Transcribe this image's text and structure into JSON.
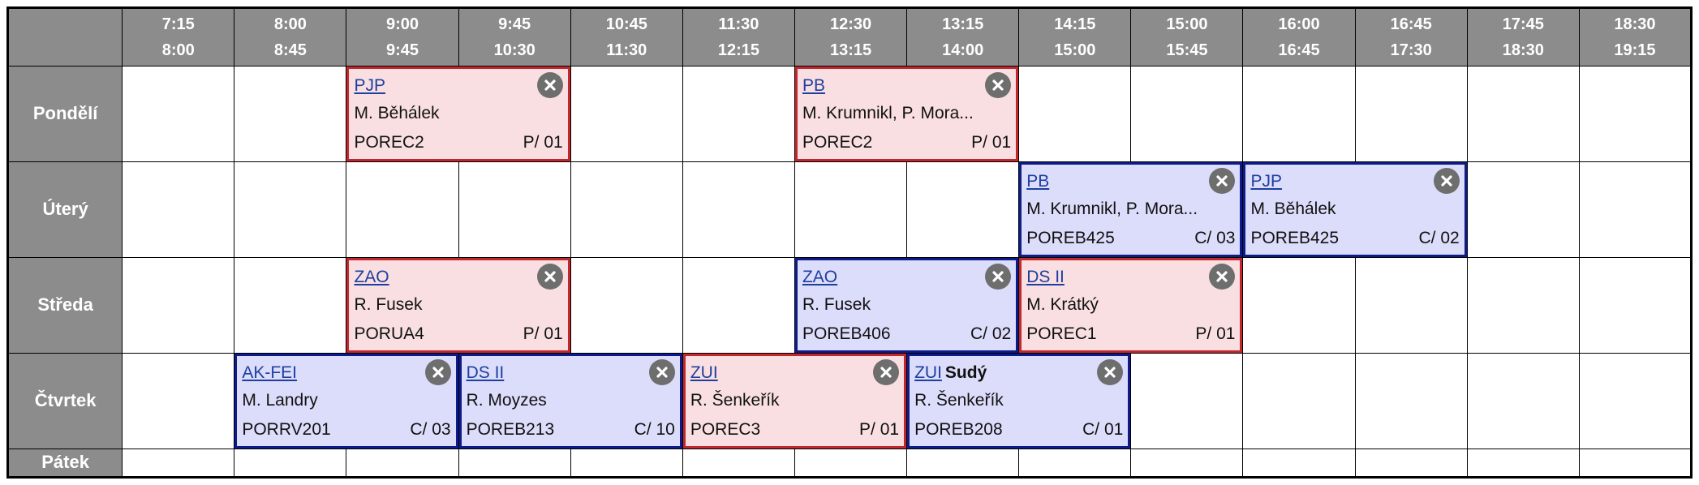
{
  "schedule": {
    "time_slots": [
      {
        "start": "7:15",
        "end": "8:00"
      },
      {
        "start": "8:00",
        "end": "8:45"
      },
      {
        "start": "9:00",
        "end": "9:45"
      },
      {
        "start": "9:45",
        "end": "10:30"
      },
      {
        "start": "10:45",
        "end": "11:30"
      },
      {
        "start": "11:30",
        "end": "12:15"
      },
      {
        "start": "12:30",
        "end": "13:15"
      },
      {
        "start": "13:15",
        "end": "14:00"
      },
      {
        "start": "14:15",
        "end": "15:00"
      },
      {
        "start": "15:00",
        "end": "15:45"
      },
      {
        "start": "16:00",
        "end": "16:45"
      },
      {
        "start": "16:45",
        "end": "17:30"
      },
      {
        "start": "17:45",
        "end": "18:30"
      },
      {
        "start": "18:30",
        "end": "19:15"
      }
    ],
    "days": [
      "Pondělí",
      "Úterý",
      "Středa",
      "Čtvrtek",
      "Pátek"
    ],
    "lessons": {
      "mon_pjp": {
        "code": "PJP",
        "teacher": "M. Běhálek",
        "room": "POREC2",
        "group": "P/ 01",
        "type": "lecture"
      },
      "mon_pb": {
        "code": "PB",
        "teacher": "M. Krumnikl, P. Mora...",
        "room": "POREC2",
        "group": "P/ 01",
        "type": "lecture"
      },
      "tue_pb": {
        "code": "PB",
        "teacher": "M. Krumnikl, P. Mora...",
        "room": "POREB425",
        "group": "C/ 03",
        "type": "exercise"
      },
      "tue_pjp": {
        "code": "PJP",
        "teacher": "M. Běhálek",
        "room": "POREB425",
        "group": "C/ 02",
        "type": "exercise"
      },
      "wed_zao_lec": {
        "code": "ZAO",
        "teacher": "R. Fusek",
        "room": "PORUA4",
        "group": "P/ 01",
        "type": "lecture"
      },
      "wed_zao_ex": {
        "code": "ZAO",
        "teacher": "R. Fusek",
        "room": "POREB406",
        "group": "C/ 02",
        "type": "exercise"
      },
      "wed_ds2": {
        "code": "DS II",
        "teacher": "M. Krátký",
        "room": "POREC1",
        "group": "P/ 01",
        "type": "lecture"
      },
      "thu_akfei": {
        "code": "AK-FEI",
        "teacher": "M. Landry",
        "room": "PORRV201",
        "group": "C/ 03",
        "type": "exercise"
      },
      "thu_ds2": {
        "code": "DS II",
        "teacher": "R. Moyzes",
        "room": "POREB213",
        "group": "C/ 10",
        "type": "exercise"
      },
      "thu_zui_lec": {
        "code": "ZUI",
        "teacher": "R. Šenkeřík",
        "room": "POREC3",
        "group": "P/ 01",
        "type": "lecture"
      },
      "thu_zui_ex": {
        "code": "ZUI",
        "week": "Sudý",
        "teacher": "R. Šenkeřík",
        "room": "POREB208",
        "group": "C/ 01",
        "type": "exercise"
      }
    }
  },
  "icons": {
    "remove": "close-circle-icon"
  },
  "colors": {
    "header_bg": "#8c8c8c",
    "lecture_bg": "#f9dfe1",
    "lecture_border": "#c1282d",
    "exercise_bg": "#dcdcfb",
    "exercise_border": "#0d1a8a",
    "link": "#1d3fa0"
  }
}
